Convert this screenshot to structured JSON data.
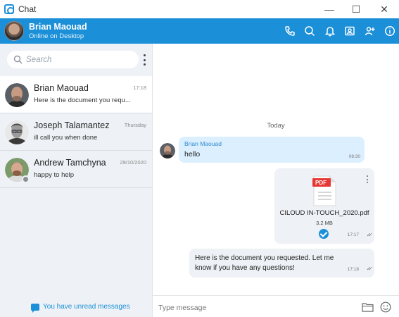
{
  "window": {
    "title": "Chat",
    "minimize_glyph": "—",
    "maximize_glyph": "☐",
    "close_glyph": "✕"
  },
  "header": {
    "name": "Brian Maouad",
    "status": "Online on Desktop",
    "accent_color": "#1b8fd8",
    "icons": [
      "phone-icon",
      "search-icon",
      "bell-icon",
      "contact-card-icon",
      "add-user-icon",
      "info-icon"
    ]
  },
  "sidebar": {
    "search_placeholder": "Search",
    "conversations": [
      {
        "name": "Brian Maouad",
        "time": "17:18",
        "preview": "Here is the document you requ...",
        "active": true
      },
      {
        "name": "Joseph Talamantez",
        "time": "Thursday",
        "preview": "ill call you when done",
        "active": false
      },
      {
        "name": "Andrew Tamchyna",
        "time": "29/10/2020",
        "preview": "happy to help",
        "active": false
      }
    ],
    "unread_notice": "You have unread messages"
  },
  "chat": {
    "day_label": "Today",
    "messages": {
      "incoming": {
        "sender": "Brian Maouad",
        "text": "hello",
        "time": "08:30"
      },
      "file": {
        "badge": "PDF",
        "name": "CILOUD IN-TOUCH_2020.pdf",
        "size": "3.2 MB",
        "time": "17:17"
      },
      "outgoing": {
        "text": "Here is the document you requested. Let me know if you have any questions!",
        "time": "17:18"
      }
    }
  },
  "composer": {
    "placeholder": "Type message"
  }
}
